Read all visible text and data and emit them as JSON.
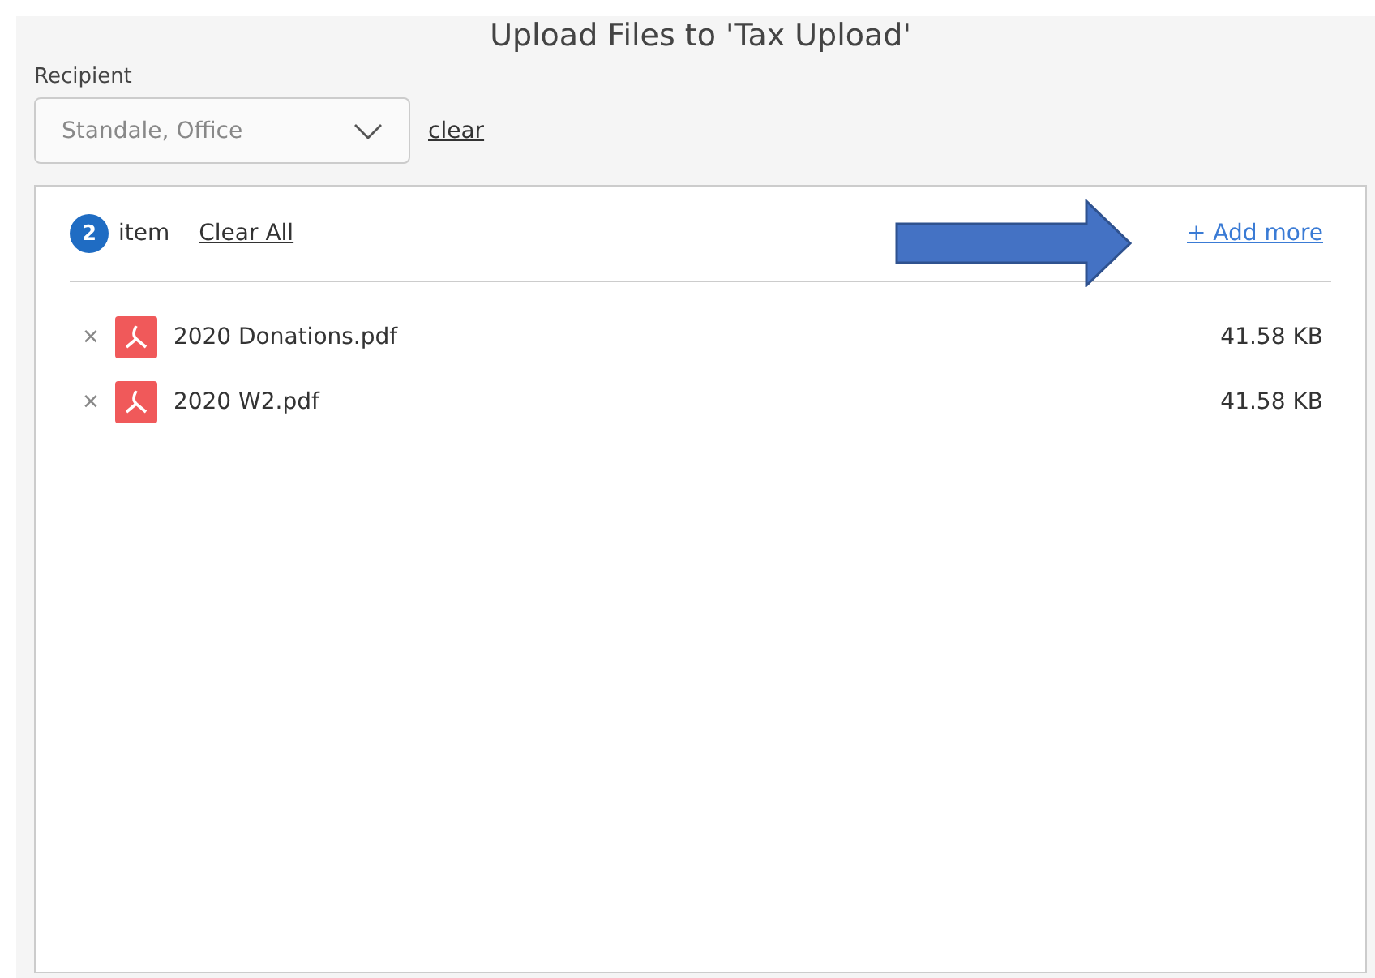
{
  "title": "Upload Files to 'Tax Upload'",
  "recipient": {
    "label": "Recipient",
    "value": "Standale, Office",
    "clear": "clear"
  },
  "list": {
    "count": "2",
    "count_label": "item",
    "clear_all": "Clear All",
    "add_more": "+ Add more",
    "files": [
      {
        "remove": "×",
        "name": "2020 Donations.pdf",
        "size": "41.58 KB"
      },
      {
        "remove": "×",
        "name": "2020 W2.pdf",
        "size": "41.58 KB"
      }
    ]
  }
}
